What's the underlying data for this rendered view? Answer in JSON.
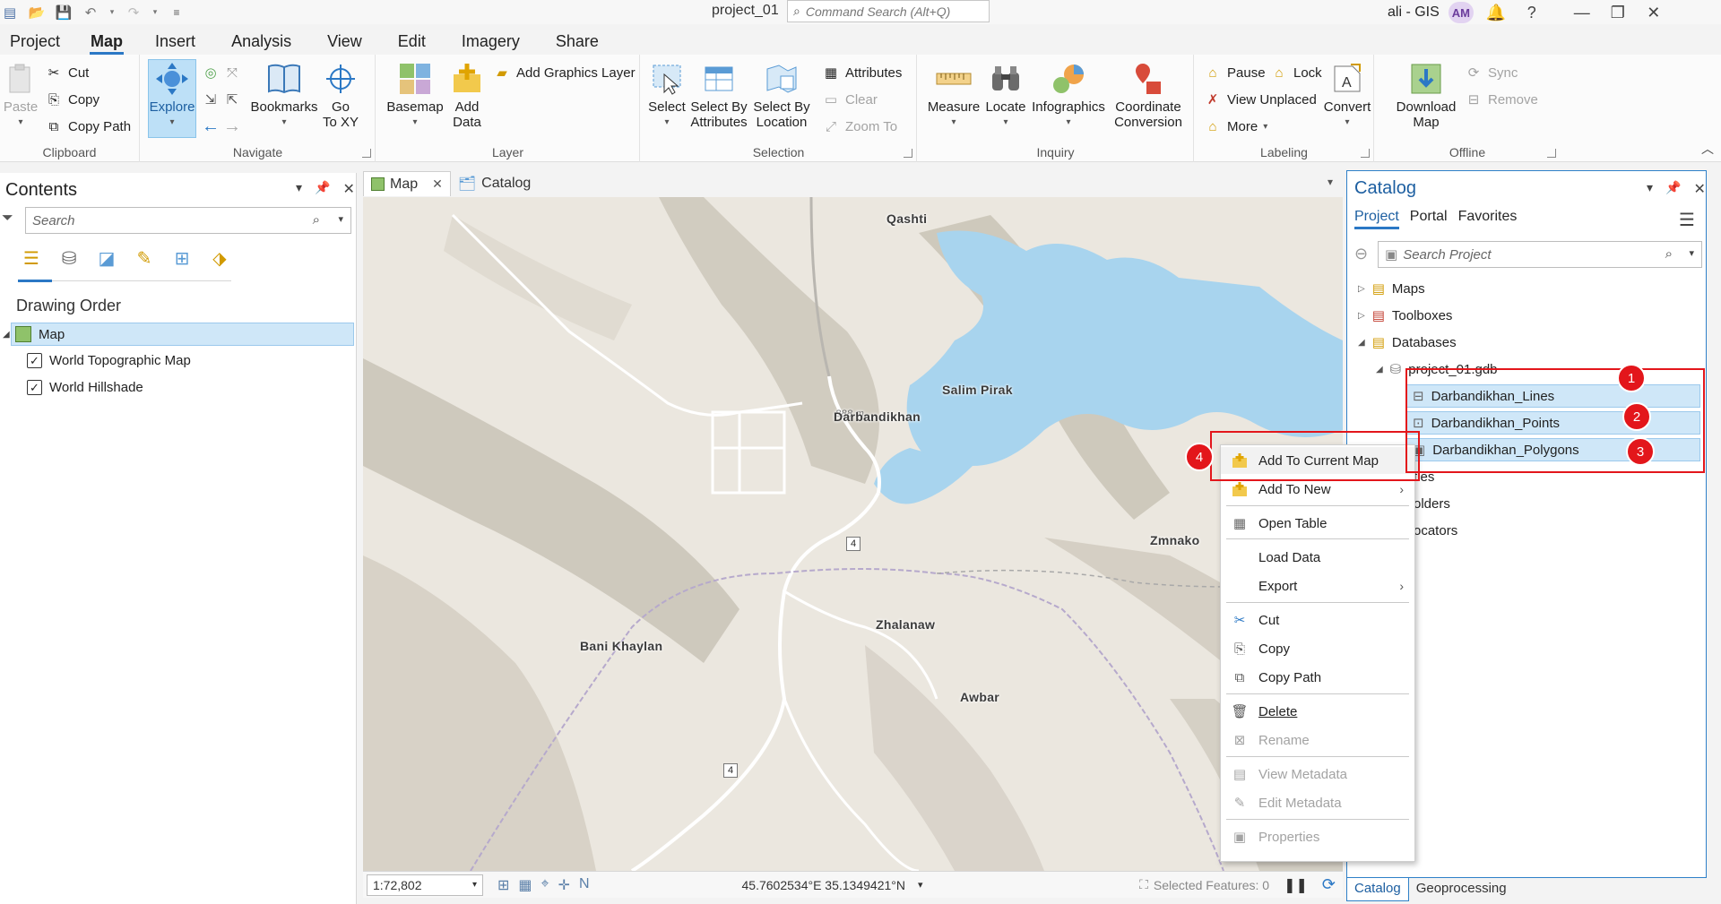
{
  "titlebar": {
    "doc_title": "project_01",
    "search_placeholder": "Command Search (Alt+Q)",
    "user_name": "ali - GIS",
    "avatar_initials": "AM",
    "help": "?"
  },
  "ribbon_tabs": [
    "Project",
    "Map",
    "Insert",
    "Analysis",
    "View",
    "Edit",
    "Imagery",
    "Share"
  ],
  "ribbon": {
    "clipboard": {
      "paste": "Paste",
      "cut": "Cut",
      "copy": "Copy",
      "copy_path": "Copy Path",
      "label": "Clipboard"
    },
    "navigate": {
      "explore": "Explore",
      "bookmarks": "Bookmarks",
      "goto_xy": "Go\nTo XY",
      "label": "Navigate"
    },
    "layer": {
      "basemap": "Basemap",
      "add_data": "Add\nData",
      "add_graphics": "Add Graphics Layer",
      "label": "Layer"
    },
    "selection": {
      "select": "Select",
      "select_by_attributes": "Select By\nAttributes",
      "select_by_location": "Select By\nLocation",
      "attributes": "Attributes",
      "clear": "Clear",
      "zoom_to": "Zoom To",
      "label": "Selection"
    },
    "inquiry": {
      "measure": "Measure",
      "locate": "Locate",
      "infographics": "Infographics",
      "coordinate_conversion": "Coordinate\nConversion",
      "label": "Inquiry"
    },
    "labeling": {
      "pause": "Pause",
      "lock": "Lock",
      "view_unplaced": "View Unplaced",
      "more": "More",
      "convert": "Convert",
      "label": "Labeling"
    },
    "offline": {
      "download_map": "Download\nMap",
      "sync": "Sync",
      "remove": "Remove",
      "label": "Offline"
    }
  },
  "contents": {
    "title": "Contents",
    "search_placeholder": "Search",
    "section": "Drawing Order",
    "map_item": "Map",
    "layers": [
      {
        "name": "World Topographic Map",
        "checked": true
      },
      {
        "name": "World Hillshade",
        "checked": true
      }
    ]
  },
  "view_tabs": [
    {
      "label": "Map",
      "active": true
    },
    {
      "label": "Catalog",
      "active": false
    }
  ],
  "map": {
    "places": [
      "Qashti",
      "Salim Pirak",
      "Darbandikhan",
      "Zmnako",
      "Zhalanaw",
      "Bani Khaylan",
      "Awbar"
    ],
    "elevation_label": "888 m",
    "road_shields": [
      "4",
      "4"
    ]
  },
  "statusbar": {
    "scale": "1:72,802",
    "coords": "45.7602534°E 35.1349421°N",
    "selected_features": "Selected Features: 0"
  },
  "catalog": {
    "title": "Catalog",
    "tabs": [
      "Project",
      "Portal",
      "Favorites"
    ],
    "search_placeholder": "Search Project",
    "tree": [
      {
        "label": "Maps"
      },
      {
        "label": "Toolboxes"
      },
      {
        "label": "Databases"
      },
      {
        "label": "project_01.gdb"
      },
      {
        "label": "Darbandikhan_Lines"
      },
      {
        "label": "Darbandikhan_Points"
      },
      {
        "label": "Darbandikhan_Polygons"
      },
      {
        "label": "ties"
      },
      {
        "label": "olders"
      },
      {
        "label": "ocators"
      }
    ]
  },
  "bottom_tabs": [
    "Catalog",
    "Geoprocessing"
  ],
  "context_menu": {
    "items": [
      {
        "label": "Add To Current Map",
        "icon": "add-icon",
        "enabled": true
      },
      {
        "label": "Add To New",
        "icon": "add-icon",
        "enabled": true,
        "submenu": true
      },
      {
        "label": "Open Table",
        "icon": "table-icon",
        "enabled": true
      },
      {
        "label": "Load Data",
        "icon": "",
        "enabled": true
      },
      {
        "label": "Export",
        "icon": "",
        "enabled": true,
        "submenu": true
      },
      {
        "label": "Cut",
        "icon": "cut-icon",
        "enabled": true
      },
      {
        "label": "Copy",
        "icon": "copy-icon",
        "enabled": true
      },
      {
        "label": "Copy Path",
        "icon": "copy-path-icon",
        "enabled": true
      },
      {
        "label": "Delete",
        "icon": "delete-icon",
        "enabled": true
      },
      {
        "label": "Rename",
        "icon": "rename-icon",
        "enabled": false
      },
      {
        "label": "View Metadata",
        "icon": "metadata-icon",
        "enabled": false
      },
      {
        "label": "Edit Metadata",
        "icon": "edit-icon",
        "enabled": false
      },
      {
        "label": "Properties",
        "icon": "properties-icon",
        "enabled": false
      }
    ]
  },
  "annotations": [
    "1",
    "2",
    "3",
    "4"
  ],
  "colors": {
    "accent": "#2b78c5",
    "annotation": "#e3161b",
    "selection": "#cfe7f8",
    "water": "#a8d4ee"
  }
}
